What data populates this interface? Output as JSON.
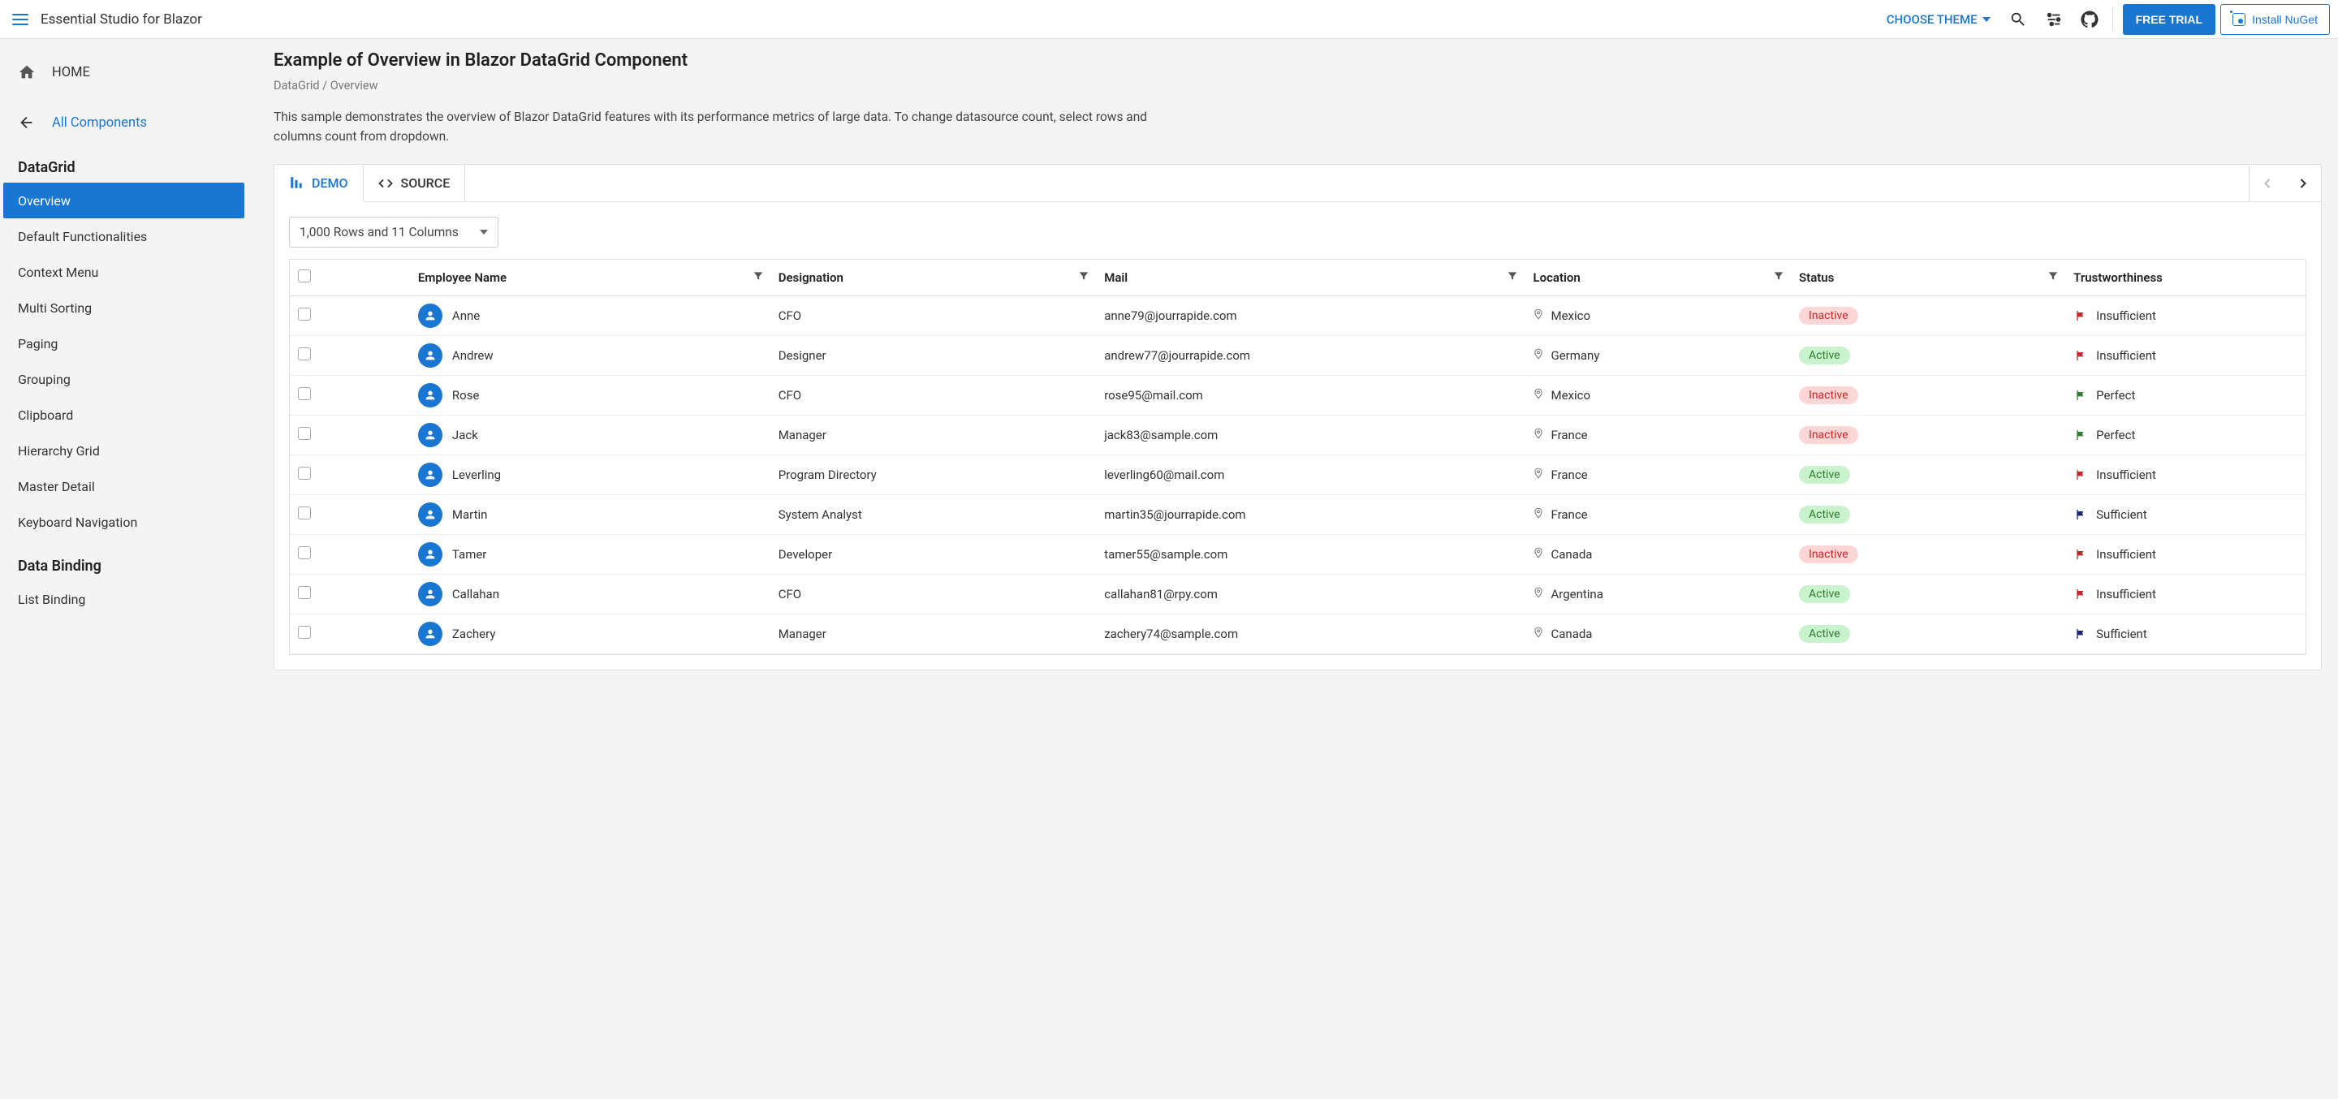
{
  "header": {
    "brand": "Essential Studio for Blazor",
    "theme_label": "CHOOSE THEME",
    "trial_label": "FREE TRIAL",
    "nuget_label": "Install NuGet"
  },
  "sidebar": {
    "home": "HOME",
    "all_components": "All Components",
    "section1_title": "DataGrid",
    "section1_items": [
      "Overview",
      "Default Functionalities",
      "Context Menu",
      "Multi Sorting",
      "Paging",
      "Grouping",
      "Clipboard",
      "Hierarchy Grid",
      "Master Detail",
      "Keyboard Navigation"
    ],
    "section2_title": "Data Binding",
    "section2_items": [
      "List Binding"
    ]
  },
  "page": {
    "title": "Example of Overview in Blazor DataGrid Component",
    "breadcrumb": "DataGrid / Overview",
    "description": "This sample demonstrates the overview of Blazor DataGrid features with its performance metrics of large data. To change datasource count, select rows and columns count from dropdown."
  },
  "tabs": {
    "demo": "DEMO",
    "source": "SOURCE"
  },
  "dropdown": {
    "value": "1,000 Rows and 11 Columns"
  },
  "grid": {
    "columns": [
      "Employee Name",
      "Designation",
      "Mail",
      "Location",
      "Status",
      "Trustworthiness"
    ],
    "rows": [
      {
        "name": "Anne",
        "designation": "CFO",
        "mail": "anne79@jourrapide.com",
        "location": "Mexico",
        "status": "Inactive",
        "trust": "Insufficient",
        "trust_color": "#c62828"
      },
      {
        "name": "Andrew",
        "designation": "Designer",
        "mail": "andrew77@jourrapide.com",
        "location": "Germany",
        "status": "Active",
        "trust": "Insufficient",
        "trust_color": "#c62828"
      },
      {
        "name": "Rose",
        "designation": "CFO",
        "mail": "rose95@mail.com",
        "location": "Mexico",
        "status": "Inactive",
        "trust": "Perfect",
        "trust_color": "#2e7d32"
      },
      {
        "name": "Jack",
        "designation": "Manager",
        "mail": "jack83@sample.com",
        "location": "France",
        "status": "Inactive",
        "trust": "Perfect",
        "trust_color": "#2e7d32"
      },
      {
        "name": "Leverling",
        "designation": "Program Directory",
        "mail": "leverling60@mail.com",
        "location": "France",
        "status": "Active",
        "trust": "Insufficient",
        "trust_color": "#c62828"
      },
      {
        "name": "Martin",
        "designation": "System Analyst",
        "mail": "martin35@jourrapide.com",
        "location": "France",
        "status": "Active",
        "trust": "Sufficient",
        "trust_color": "#1a237e"
      },
      {
        "name": "Tamer",
        "designation": "Developer",
        "mail": "tamer55@sample.com",
        "location": "Canada",
        "status": "Inactive",
        "trust": "Insufficient",
        "trust_color": "#c62828"
      },
      {
        "name": "Callahan",
        "designation": "CFO",
        "mail": "callahan81@rpy.com",
        "location": "Argentina",
        "status": "Active",
        "trust": "Insufficient",
        "trust_color": "#c62828"
      },
      {
        "name": "Zachery",
        "designation": "Manager",
        "mail": "zachery74@sample.com",
        "location": "Canada",
        "status": "Active",
        "trust": "Sufficient",
        "trust_color": "#1a237e"
      }
    ]
  }
}
